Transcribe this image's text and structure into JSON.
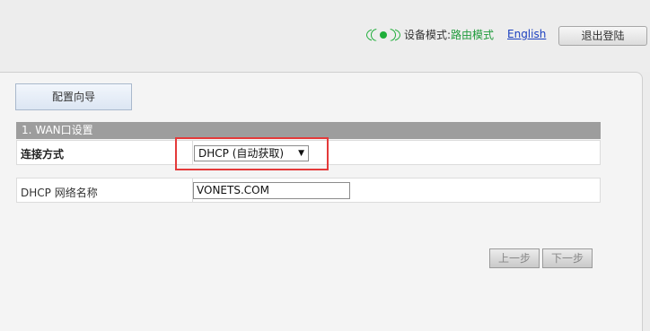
{
  "header": {
    "mode_label": "设备模式:",
    "mode_value": "路由模式",
    "language_link": "English",
    "logout_label": "退出登陆",
    "status_color": "#1fae3a"
  },
  "tabs": [
    {
      "label": "配置向导"
    }
  ],
  "section": {
    "title": "1. WAN口设置",
    "connection_label": "连接方式",
    "connection_value": "DHCP (自动获取)",
    "network_name_label": "DHCP 网络名称",
    "network_name_value": "VONETS.COM"
  },
  "buttons": {
    "prev_label": "上一步",
    "next_label": "下一步"
  },
  "highlight_color": "#e43a3a"
}
